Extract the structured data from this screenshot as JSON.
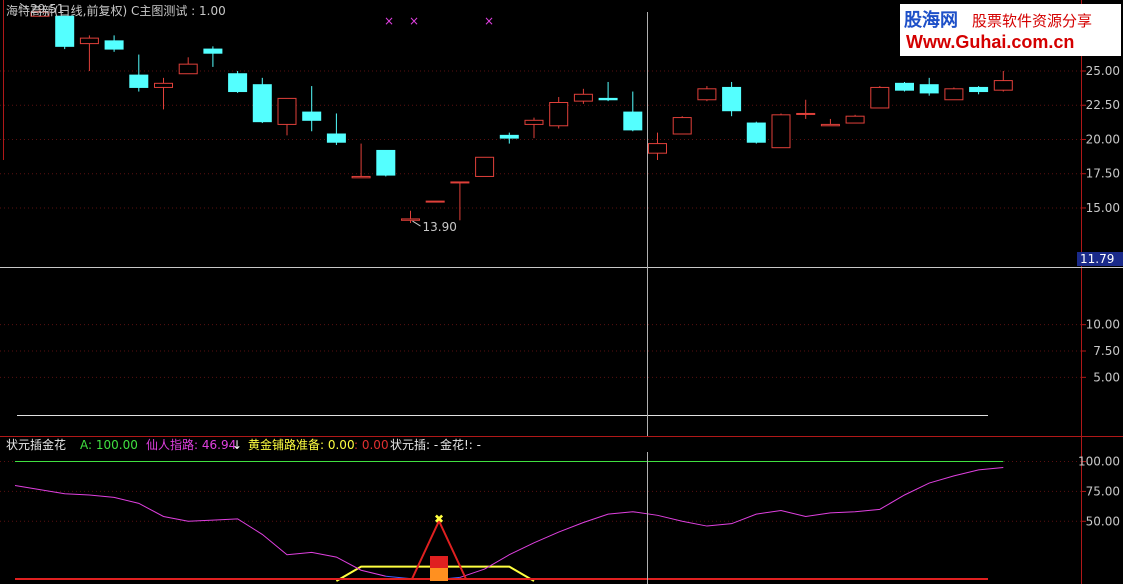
{
  "header": {
    "title": "海特高新(日线,前复权) C主图测试 : 1.00",
    "indicator_name": "状元插金花",
    "a_label": "A: 100.00",
    "xianren_label": "仙人指路: 46.94",
    "arrow_glyph": "↓",
    "huangjin_label": "黄金铺路准备: 0.00",
    "red_value": ": 0.00",
    "zhuangyuan_label": "状元插: -",
    "jinhua_label": "金花!: -"
  },
  "watermark": {
    "cn_brand": "股海网",
    "slogan": "股票软件资源分享",
    "url": "Www.Guhai.com.cn"
  },
  "colors": {
    "up": "#e0403a",
    "down": "#54ffff",
    "axis": "#b01818",
    "magenta": "#e040e0",
    "yellow": "#ffff40",
    "green": "#40e040",
    "orange": "#ff9020"
  },
  "chart_data": [
    {
      "type": "candlestick",
      "title": "海特高新(日线,前复权) C主图测试 : 1.00",
      "ylim": [
        11.2,
        29.6
      ],
      "yticks": [
        "25.00",
        "22.50",
        "20.00",
        "17.50",
        "15.00"
      ],
      "max_label": "29.51",
      "min_label": "13.90",
      "candles": [
        {
          "o": 29.0,
          "h": 29.51,
          "l": 29.0,
          "c": 29.3
        },
        {
          "o": 29.0,
          "h": 29.0,
          "l": 26.6,
          "c": 26.8
        },
        {
          "o": 27.0,
          "h": 27.6,
          "l": 25.0,
          "c": 27.4
        },
        {
          "o": 27.2,
          "h": 27.6,
          "l": 26.4,
          "c": 26.6
        },
        {
          "o": 24.7,
          "h": 26.2,
          "l": 23.5,
          "c": 23.8
        },
        {
          "o": 23.8,
          "h": 24.5,
          "l": 22.2,
          "c": 24.1
        },
        {
          "o": 24.8,
          "h": 26.0,
          "l": 24.8,
          "c": 25.5
        },
        {
          "o": 26.6,
          "h": 26.8,
          "l": 25.3,
          "c": 26.3
        },
        {
          "o": 24.8,
          "h": 25.0,
          "l": 23.4,
          "c": 23.5
        },
        {
          "o": 24.0,
          "h": 24.5,
          "l": 21.2,
          "c": 21.3
        },
        {
          "o": 21.1,
          "h": 23.0,
          "l": 20.3,
          "c": 23.0
        },
        {
          "o": 22.0,
          "h": 23.9,
          "l": 20.6,
          "c": 21.4
        },
        {
          "o": 20.4,
          "h": 21.9,
          "l": 19.6,
          "c": 19.8
        },
        {
          "o": 17.2,
          "h": 19.7,
          "l": 17.2,
          "c": 17.3
        },
        {
          "o": 19.2,
          "h": 19.2,
          "l": 17.3,
          "c": 17.4
        },
        {
          "o": 14.1,
          "h": 14.8,
          "l": 13.9,
          "c": 14.2
        },
        {
          "o": 15.5,
          "h": 15.5,
          "l": 15.4,
          "c": 15.5
        },
        {
          "o": 16.9,
          "h": 16.9,
          "l": 14.1,
          "c": 16.9
        },
        {
          "o": 17.3,
          "h": 18.7,
          "l": 17.3,
          "c": 18.7
        },
        {
          "o": 20.3,
          "h": 20.5,
          "l": 19.7,
          "c": 20.1
        },
        {
          "o": 21.1,
          "h": 21.6,
          "l": 20.1,
          "c": 21.4
        },
        {
          "o": 21.0,
          "h": 23.1,
          "l": 20.8,
          "c": 22.7
        },
        {
          "o": 22.8,
          "h": 23.7,
          "l": 22.6,
          "c": 23.3
        },
        {
          "o": 23.0,
          "h": 24.2,
          "l": 22.8,
          "c": 22.9
        },
        {
          "o": 22.0,
          "h": 23.5,
          "l": 20.6,
          "c": 20.7
        },
        {
          "o": 19.0,
          "h": 20.5,
          "l": 18.5,
          "c": 19.7
        },
        {
          "o": 20.4,
          "h": 21.7,
          "l": 20.4,
          "c": 21.6
        },
        {
          "o": 22.9,
          "h": 23.9,
          "l": 22.8,
          "c": 23.7
        },
        {
          "o": 23.8,
          "h": 24.2,
          "l": 21.7,
          "c": 22.1
        },
        {
          "o": 21.2,
          "h": 21.3,
          "l": 19.7,
          "c": 19.8
        },
        {
          "o": 19.4,
          "h": 21.9,
          "l": 19.4,
          "c": 21.8
        },
        {
          "o": 21.9,
          "h": 22.9,
          "l": 21.5,
          "c": 21.9
        },
        {
          "o": 21.0,
          "h": 21.5,
          "l": 21.0,
          "c": 21.1
        },
        {
          "o": 21.2,
          "h": 21.8,
          "l": 21.2,
          "c": 21.7
        },
        {
          "o": 22.3,
          "h": 23.9,
          "l": 22.3,
          "c": 23.8
        },
        {
          "o": 24.1,
          "h": 24.2,
          "l": 23.5,
          "c": 23.6
        },
        {
          "o": 24.0,
          "h": 24.5,
          "l": 23.2,
          "c": 23.4
        },
        {
          "o": 22.9,
          "h": 23.8,
          "l": 22.9,
          "c": 23.7
        },
        {
          "o": 23.8,
          "h": 23.9,
          "l": 23.3,
          "c": 23.5
        },
        {
          "o": 23.6,
          "h": 25.0,
          "l": 23.5,
          "c": 24.3
        }
      ]
    },
    {
      "type": "line",
      "ylim": [
        0,
        15
      ],
      "yticks": [
        "10.00",
        "7.50",
        "5.00"
      ],
      "cursor_value": "11.79"
    },
    {
      "type": "line",
      "title": "状元插金花",
      "ylim": [
        0,
        108
      ],
      "yticks": [
        "100.00",
        "75.00",
        "50.00"
      ],
      "series": [
        {
          "name": "A",
          "color": "#40e040",
          "values": [
            100,
            100,
            100,
            100,
            100,
            100,
            100,
            100,
            100,
            100,
            100,
            100,
            100,
            100,
            100,
            100,
            100,
            100,
            100,
            100,
            100,
            100,
            100,
            100,
            100,
            100,
            100,
            100,
            100,
            100,
            100,
            100,
            100,
            100,
            100,
            100,
            100,
            100,
            100,
            100
          ]
        },
        {
          "name": "仙人指路",
          "color": "#e040e0",
          "values": [
            80,
            73,
            72,
            70,
            65,
            54,
            50,
            51,
            52,
            39,
            22,
            24,
            20,
            9,
            4,
            2,
            1,
            3,
            10,
            22,
            32,
            41,
            49,
            56,
            58,
            55,
            50,
            46,
            48,
            56,
            59,
            54,
            57,
            58,
            60,
            72,
            82,
            88,
            93,
            95
          ]
        },
        {
          "name": "黄金铺路准备",
          "color": "#ffff40",
          "values": [
            null,
            null,
            null,
            null,
            null,
            null,
            null,
            null,
            null,
            null,
            null,
            null,
            0,
            12,
            12,
            12,
            12,
            12,
            12,
            12,
            0,
            null,
            null,
            null,
            null,
            null,
            null,
            null,
            null,
            null,
            null,
            null,
            null,
            null,
            null,
            null,
            null,
            null,
            null,
            null
          ]
        }
      ]
    }
  ]
}
